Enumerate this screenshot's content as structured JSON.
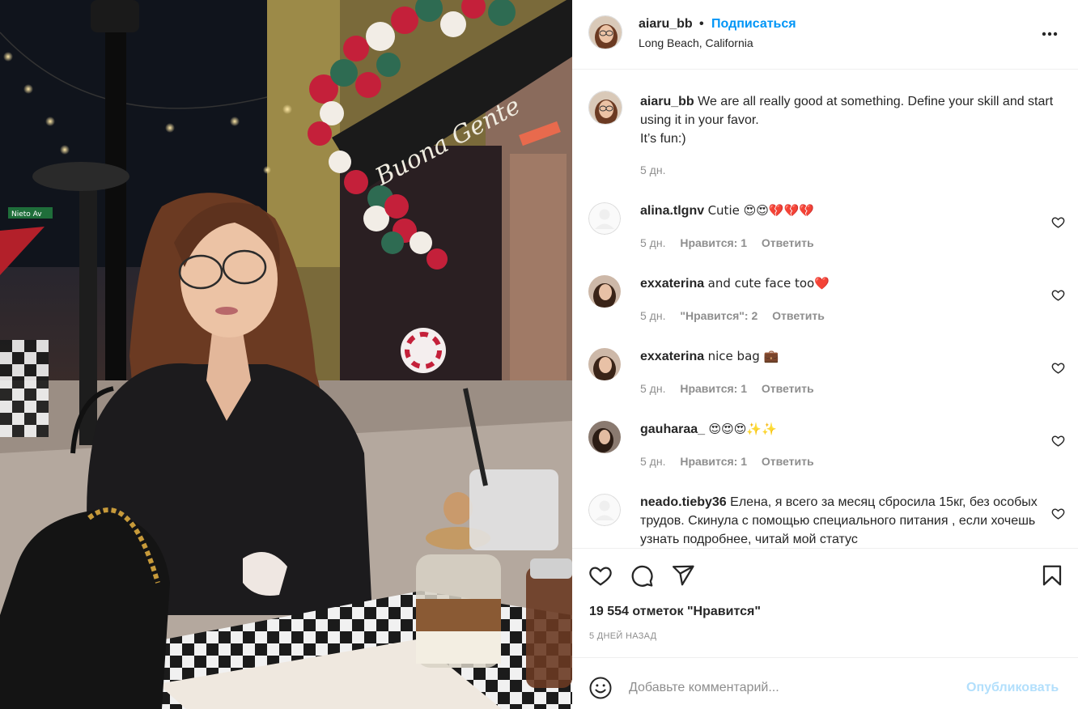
{
  "post": {
    "author": "aiaru_bb",
    "separator": "•",
    "follow_label": "Подписаться",
    "location": "Long Beach, California",
    "more_icon": "more-horizontal-icon",
    "image_sign_text": "Buona Gente",
    "street_sign_text": "Nieto Av"
  },
  "caption": {
    "user": "aiaru_bb",
    "text": "We are all really good at something. Define your skill and start using it in your favor.",
    "text_line2": "It’s fun:)",
    "time": "5 дн."
  },
  "comments": [
    {
      "user": "alina.tlgnv",
      "text": "Cutie 😍😍💔💔💔",
      "time": "5 дн.",
      "likes": "Нравится: 1",
      "reply": "Ответить"
    },
    {
      "user": "exxaterina",
      "text": "and cute face too❤️",
      "time": "5 дн.",
      "likes": "\"Нравится\": 2",
      "reply": "Ответить"
    },
    {
      "user": "exxaterina",
      "text": "nice bag 💼",
      "time": "5 дн.",
      "likes": "Нравится: 1",
      "reply": "Ответить"
    },
    {
      "user": "gauharaa_",
      "text": "😍😍😍✨✨",
      "time": "5 дн.",
      "likes": "Нравится: 1",
      "reply": "Ответить"
    },
    {
      "user": "neado.tieby36",
      "text": "Елена, я всего за месяц сбросила 15кг, без особых трудов. Скинула с помощью специального питания , если хочешь узнать подробнее, читай мой статус",
      "time": "",
      "likes": "",
      "reply": ""
    }
  ],
  "actions": {
    "like_icon": "heart-icon",
    "comment_icon": "comment-icon",
    "share_icon": "share-icon",
    "save_icon": "bookmark-icon",
    "likes_count": "19 554 отметок \"Нравится\"",
    "date": "5 ДНЕЙ НАЗАД"
  },
  "add_comment": {
    "emoji_icon": "smile-icon",
    "placeholder": "Добавьте комментарий...",
    "publish_label": "Опубликовать"
  },
  "colors": {
    "link_blue": "#0095f6",
    "publish_disabled": "#b2dffc",
    "secondary_text": "#8e8e8e",
    "heart_red": "#d0163f"
  }
}
